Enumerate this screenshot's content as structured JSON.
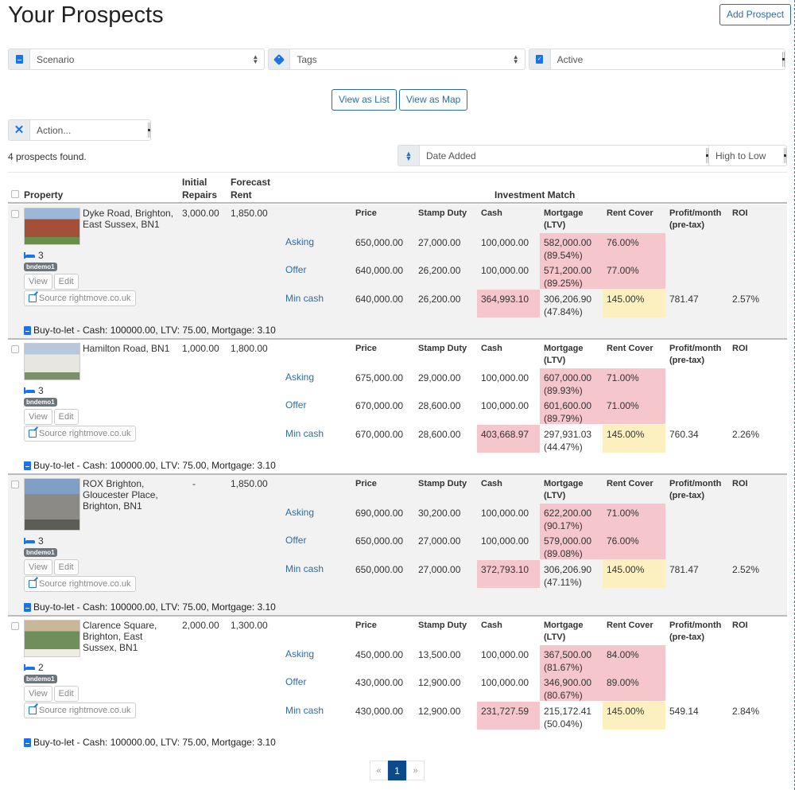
{
  "header": {
    "title": "Your Prospects",
    "add_button": "Add Prospect"
  },
  "filters": {
    "scenario": {
      "icon": "scenario-book-icon",
      "value": "Scenario"
    },
    "tags": {
      "icon": "tag-icon",
      "value": "Tags"
    },
    "status": {
      "icon": "clipboard-check-icon",
      "value": "Active"
    }
  },
  "views": {
    "list": "View as List",
    "map": "View as Map"
  },
  "action": {
    "icon": "tools-icon",
    "value": "Action..."
  },
  "results": {
    "count_text": "4 prospects found."
  },
  "sort": {
    "icon": "sort-icon",
    "field": "Date Added",
    "order": "High to Low"
  },
  "table": {
    "headers": {
      "property": "Property",
      "initial_repairs_1": "Initial",
      "initial_repairs_2": "Repairs",
      "forecast_rent_1": "Forecast",
      "forecast_rent_2": "Rent",
      "investment_match": "Investment Match"
    },
    "investment_columns": {
      "price": "Price",
      "stamp_duty": "Stamp Duty",
      "cash": "Cash",
      "mortgage_1": "Mortgage",
      "mortgage_2": "(LTV)",
      "rent_cover": "Rent Cover",
      "profit_1": "Profit/month",
      "profit_2": "(pre-tax)",
      "roi": "ROI"
    },
    "row_labels": {
      "asking": "Asking",
      "offer": "Offer",
      "min_cash": "Min cash"
    },
    "buttons": {
      "view": "View",
      "edit": "Edit",
      "source": "Source rightmove.co.uk"
    },
    "colors": {
      "bad": "#f5c6cb",
      "warn": "#fdf0c0"
    }
  },
  "prospects": [
    {
      "address": "Dyke Road, Brighton, East Sussex, BN1",
      "initial_repairs": "3,000.00",
      "forecast_rent": "1,850.00",
      "bedrooms": "3",
      "tag": "bndemo1",
      "scenario": "Buy-to-let - Cash: 100000.00, LTV: 75.00, Mortgage: 3.10",
      "asking": {
        "price": "650,000.00",
        "stamp_duty": "27,000.00",
        "cash": "100,000.00",
        "mortgage": "582,000.00",
        "ltv": "(89.54%)",
        "rent_cover": "76.00%"
      },
      "offer": {
        "price": "640,000.00",
        "stamp_duty": "26,200.00",
        "cash": "100,000.00",
        "mortgage": "571,200.00",
        "ltv": "(89.25%)",
        "rent_cover": "77.00%"
      },
      "min_cash": {
        "price": "640,000.00",
        "stamp_duty": "26,200.00",
        "cash": "364,993.10",
        "mortgage": "306,206.90",
        "ltv": "(47.84%)",
        "rent_cover": "145.00%",
        "profit": "781.47",
        "roi": "2.57%"
      }
    },
    {
      "address": "Hamilton Road, BN1",
      "initial_repairs": "1,000.00",
      "forecast_rent": "1,800.00",
      "bedrooms": "3",
      "tag": "bndemo1",
      "scenario": "Buy-to-let - Cash: 100000.00, LTV: 75.00, Mortgage: 3.10",
      "asking": {
        "price": "675,000.00",
        "stamp_duty": "29,000.00",
        "cash": "100,000.00",
        "mortgage": "607,000.00",
        "ltv": "(89.93%)",
        "rent_cover": "71.00%"
      },
      "offer": {
        "price": "670,000.00",
        "stamp_duty": "28,600.00",
        "cash": "100,000.00",
        "mortgage": "601,600.00",
        "ltv": "(89.79%)",
        "rent_cover": "71.00%"
      },
      "min_cash": {
        "price": "670,000.00",
        "stamp_duty": "28,600.00",
        "cash": "403,668.97",
        "mortgage": "297,931.03",
        "ltv": "(44.47%)",
        "rent_cover": "145.00%",
        "profit": "760.34",
        "roi": "2.26%"
      }
    },
    {
      "address": "ROX Brighton, Gloucester Place, Brighton, BN1",
      "initial_repairs": "-",
      "forecast_rent": "1,850.00",
      "bedrooms": "3",
      "tag": "bndemo1",
      "scenario": "Buy-to-let - Cash: 100000.00, LTV: 75.00, Mortgage: 3.10",
      "asking": {
        "price": "690,000.00",
        "stamp_duty": "30,200.00",
        "cash": "100,000.00",
        "mortgage": "622,200.00",
        "ltv": "(90.17%)",
        "rent_cover": "71.00%"
      },
      "offer": {
        "price": "650,000.00",
        "stamp_duty": "27,000.00",
        "cash": "100,000.00",
        "mortgage": "579,000.00",
        "ltv": "(89.08%)",
        "rent_cover": "76.00%"
      },
      "min_cash": {
        "price": "650,000.00",
        "stamp_duty": "27,000.00",
        "cash": "372,793.10",
        "mortgage": "306,206.90",
        "ltv": "(47.11%)",
        "rent_cover": "145.00%",
        "profit": "781.47",
        "roi": "2.52%"
      }
    },
    {
      "address": "Clarence Square, Brighton, East Sussex, BN1",
      "initial_repairs": "2,000.00",
      "forecast_rent": "1,300.00",
      "bedrooms": "2",
      "tag": "bndemo1",
      "scenario": "Buy-to-let - Cash: 100000.00, LTV: 75.00, Mortgage: 3.10",
      "asking": {
        "price": "450,000.00",
        "stamp_duty": "13,500.00",
        "cash": "100,000.00",
        "mortgage": "367,500.00",
        "ltv": "(81.67%)",
        "rent_cover": "84.00%"
      },
      "offer": {
        "price": "430,000.00",
        "stamp_duty": "12,900.00",
        "cash": "100,000.00",
        "mortgage": "346,900.00",
        "ltv": "(80.67%)",
        "rent_cover": "89.00%"
      },
      "min_cash": {
        "price": "430,000.00",
        "stamp_duty": "12,900.00",
        "cash": "231,727.59",
        "mortgage": "215,172.41",
        "ltv": "(50.04%)",
        "rent_cover": "145.00%",
        "profit": "549.14",
        "roi": "2.84%"
      }
    }
  ],
  "pagination": {
    "prev": "«",
    "current": "1",
    "next": "»"
  }
}
